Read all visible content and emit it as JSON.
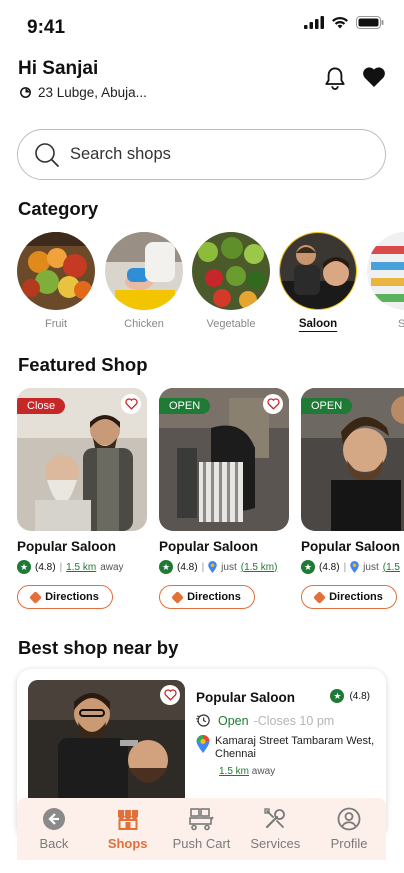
{
  "status": {
    "time": "9:41"
  },
  "header": {
    "greeting": "Hi Sanjai",
    "location": "23 Lubge, Abuja..."
  },
  "search": {
    "placeholder": "Search shops"
  },
  "category": {
    "title": "Category",
    "items": [
      {
        "label": "Fruit"
      },
      {
        "label": "Chicken"
      },
      {
        "label": "Vegetable"
      },
      {
        "label": "Saloon"
      },
      {
        "label": "Sal"
      }
    ]
  },
  "featured": {
    "title": "Featured Shop",
    "shops": [
      {
        "status": "Close",
        "name": "Popular Saloon",
        "rating": "(4.8)",
        "distance": "1.5 km",
        "suffix": "away",
        "prefix": "",
        "directions": "Directions"
      },
      {
        "status": "OPEN",
        "name": "Popular Saloon",
        "rating": "(4.8)",
        "distance": "(1.5 km)",
        "suffix": "",
        "prefix": "just",
        "directions": "Directions"
      },
      {
        "status": "OPEN",
        "name": "Popular Saloon",
        "rating": "(4.8)",
        "distance": "(1.5",
        "suffix": "",
        "prefix": "just",
        "directions": "Directions"
      }
    ]
  },
  "best": {
    "title": "Best  shop near by",
    "name": "Popular Saloon",
    "rating": "(4.8)",
    "open": "Open",
    "closes": "-Closes 10 pm",
    "address": "Kamaraj Street Tambaram West, Chennai",
    "distance": "1.5 km",
    "distance_suffix": "away"
  },
  "nav": {
    "items": [
      {
        "label": "Back"
      },
      {
        "label": "Shops"
      },
      {
        "label": "Push Cart"
      },
      {
        "label": "Services"
      },
      {
        "label": "Profile"
      }
    ]
  },
  "colors": {
    "accent": "#e1703a",
    "open": "#1e7a34",
    "close": "#c62828"
  }
}
